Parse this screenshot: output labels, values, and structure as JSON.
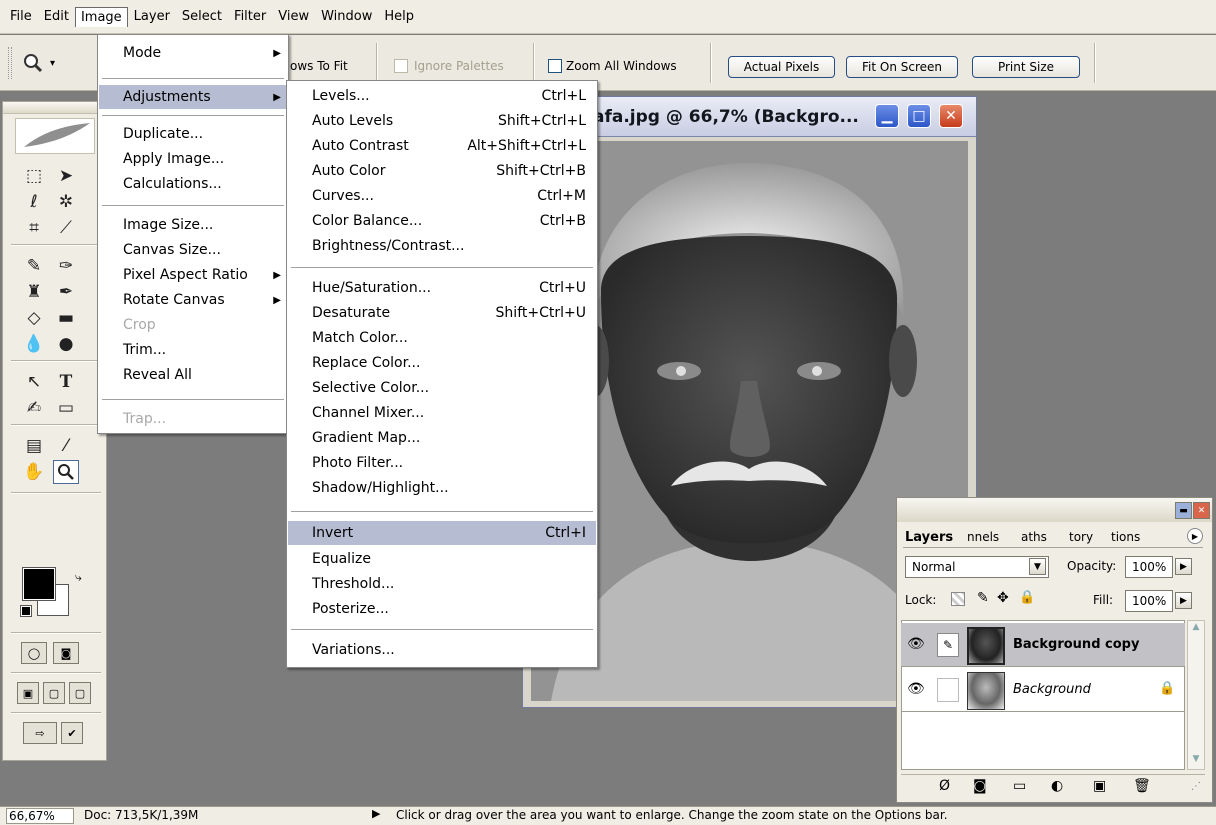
{
  "menubar": {
    "items": [
      "File",
      "Edit",
      "Image",
      "Layer",
      "Select",
      "Filter",
      "View",
      "Window",
      "Help"
    ],
    "active": "Image"
  },
  "options_bar": {
    "zoom_tool_icon": "zoom-icon",
    "resize_windows_partial": "ows To Fit",
    "ignore_palettes": "Ignore Palettes",
    "zoom_all_windows": "Zoom All Windows",
    "actual_pixels": "Actual Pixels",
    "fit_on_screen": "Fit On Screen",
    "print_size": "Print Size"
  },
  "image_menu": {
    "items": [
      {
        "label": "Mode",
        "submenu": true
      },
      {
        "label": "Adjustments",
        "submenu": true,
        "highlighted": true
      },
      {
        "label": "Duplicate..."
      },
      {
        "label": "Apply Image..."
      },
      {
        "label": "Calculations..."
      },
      {
        "label": "Image Size..."
      },
      {
        "label": "Canvas Size..."
      },
      {
        "label": "Pixel Aspect Ratio",
        "submenu": true
      },
      {
        "label": "Rotate Canvas",
        "submenu": true
      },
      {
        "label": "Crop",
        "disabled": true
      },
      {
        "label": "Trim..."
      },
      {
        "label": "Reveal All"
      },
      {
        "label": "Trap...",
        "disabled": true
      }
    ]
  },
  "adjustments_menu": {
    "items": [
      {
        "label": "Levels...",
        "shortcut": "Ctrl+L"
      },
      {
        "label": "Auto Levels",
        "shortcut": "Shift+Ctrl+L"
      },
      {
        "label": "Auto Contrast",
        "shortcut": "Alt+Shift+Ctrl+L"
      },
      {
        "label": "Auto Color",
        "shortcut": "Shift+Ctrl+B"
      },
      {
        "label": "Curves...",
        "shortcut": "Ctrl+M"
      },
      {
        "label": "Color Balance...",
        "shortcut": "Ctrl+B"
      },
      {
        "label": "Brightness/Contrast...",
        "shortcut": ""
      },
      {
        "label": "Hue/Saturation...",
        "shortcut": "Ctrl+U"
      },
      {
        "label": "Desaturate",
        "shortcut": "Shift+Ctrl+U"
      },
      {
        "label": "Match Color...",
        "shortcut": ""
      },
      {
        "label": "Replace Color...",
        "shortcut": ""
      },
      {
        "label": "Selective Color...",
        "shortcut": ""
      },
      {
        "label": "Channel Mixer...",
        "shortcut": ""
      },
      {
        "label": "Gradient Map...",
        "shortcut": ""
      },
      {
        "label": "Photo Filter...",
        "shortcut": ""
      },
      {
        "label": "Shadow/Highlight...",
        "shortcut": ""
      },
      {
        "label": "Invert",
        "shortcut": "Ctrl+I",
        "highlighted": true
      },
      {
        "label": "Equalize",
        "shortcut": ""
      },
      {
        "label": "Threshold...",
        "shortcut": ""
      },
      {
        "label": "Posterize...",
        "shortcut": ""
      },
      {
        "label": "Variations...",
        "shortcut": ""
      }
    ]
  },
  "image_window": {
    "title": "afa.jpg @ 66,7% (Backgro..."
  },
  "layers_panel": {
    "tabs": [
      "Layers",
      "nnels",
      "aths",
      "tory",
      "tions"
    ],
    "blend_mode": "Normal",
    "opacity_label": "Opacity:",
    "opacity_value": "100%",
    "lock_label": "Lock:",
    "fill_label": "Fill:",
    "fill_value": "100%",
    "layers": [
      {
        "name": "Background copy",
        "visible": true,
        "selected": true,
        "locked": false
      },
      {
        "name": "Background",
        "visible": true,
        "selected": false,
        "locked": true
      }
    ]
  },
  "status_bar": {
    "zoom": "66,67%",
    "doc": "Doc: 713,5K/1,39M",
    "hint": "Click or drag over the area you want to enlarge. Change the zoom state on the Options bar."
  },
  "colors": {
    "menu_highlight": "#b6bdd2",
    "workspace": "#7c7c7c",
    "chrome": "#efede4"
  }
}
